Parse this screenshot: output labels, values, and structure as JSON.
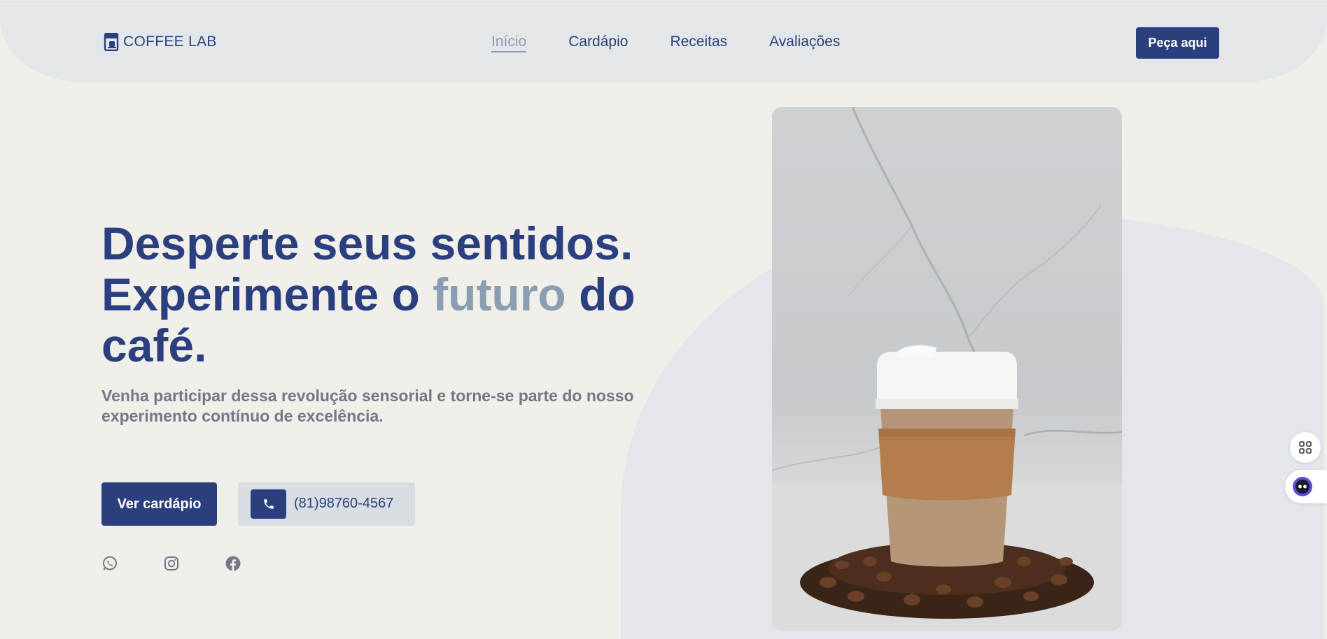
{
  "header": {
    "brand": "COFFEE LAB",
    "nav": [
      "Início",
      "Cardápio",
      "Receitas",
      "Avaliações"
    ],
    "active_nav": "Início",
    "order_button": "Peça aqui"
  },
  "hero": {
    "title_line1": "Desperte seus sentidos.",
    "title_line2_a": "Experimente o ",
    "title_line2_accent": "futuro",
    "title_line2_b": " do",
    "title_line3": "café.",
    "subtitle": "Venha participar dessa revolução sensorial e torne-se parte do nosso experimento contínuo de excelência.",
    "cta_button": "Ver cardápio",
    "phone": "(81)98760-4567"
  },
  "socials": [
    "whatsapp-icon",
    "instagram-icon",
    "facebook-icon"
  ],
  "colors": {
    "primary": "#2b3f7e",
    "accent": "#8b9db0",
    "background": "#f0efea",
    "header_bg": "#e4e7ea",
    "muted_text": "#797486"
  }
}
